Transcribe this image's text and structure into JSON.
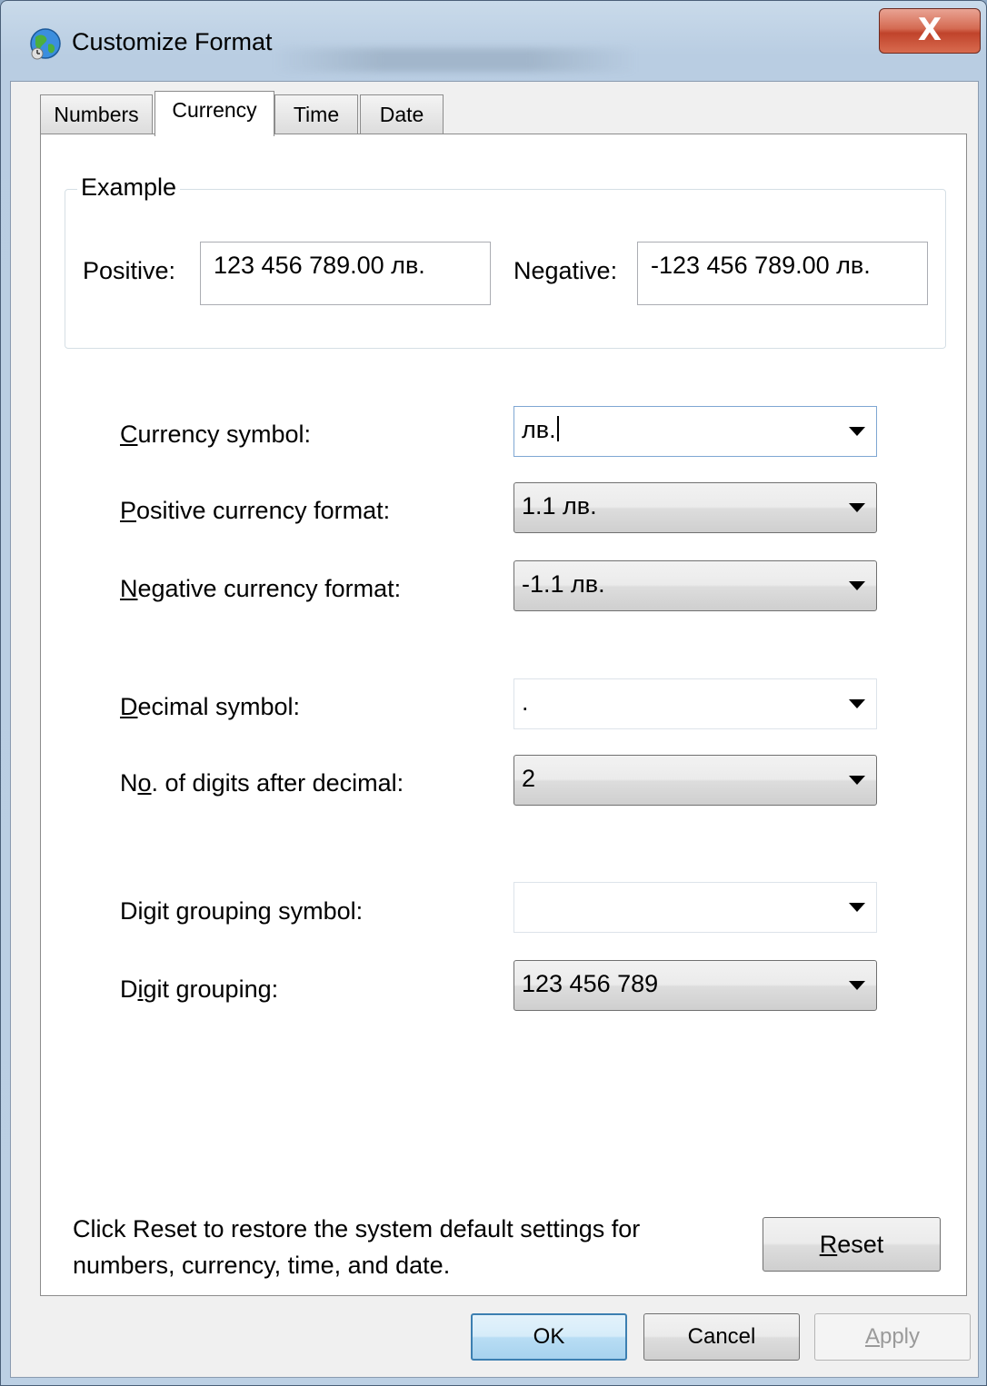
{
  "window": {
    "title": "Customize Format",
    "close_glyph": "X",
    "icon": "globe-icon"
  },
  "tabs": [
    {
      "label": "Numbers",
      "active": false
    },
    {
      "label": "Currency",
      "active": true
    },
    {
      "label": "Time",
      "active": false
    },
    {
      "label": "Date",
      "active": false
    }
  ],
  "example": {
    "title": "Example",
    "positive_label": "Positive:",
    "positive_value": "123 456 789.00 лв.",
    "negative_label": "Negative:",
    "negative_value": "-123 456 789.00 лв."
  },
  "fields": {
    "currency_symbol": {
      "label_key": "C",
      "label_rest": "urrency symbol:",
      "value": "лв."
    },
    "positive_format": {
      "label_key": "P",
      "label_rest": "ositive currency format:",
      "value": "1.1 лв."
    },
    "negative_format": {
      "label_key": "N",
      "label_rest": "egative currency format:",
      "value": "-1.1 лв."
    },
    "decimal_symbol": {
      "label_key": "D",
      "label_rest": "ecimal symbol:",
      "value": "."
    },
    "digits_after_decimal": {
      "label_pre": "N",
      "label_key": "o",
      "label_rest": ". of digits after decimal:",
      "value": "2"
    },
    "grouping_symbol": {
      "label_pre": "Di",
      "label_key": "g",
      "label_rest": "it grouping symbol:",
      "value": ""
    },
    "digit_grouping": {
      "label_pre": "D",
      "label_key": "i",
      "label_rest": "git grouping:",
      "value": "123 456 789"
    }
  },
  "reset": {
    "text_line1": "Click Reset to restore the system default settings for",
    "text_line2": "numbers, currency, time, and date.",
    "button_key": "R",
    "button_rest": "eset"
  },
  "buttons": {
    "ok": "OK",
    "cancel": "Cancel",
    "apply_key": "A",
    "apply_rest": "pply"
  }
}
